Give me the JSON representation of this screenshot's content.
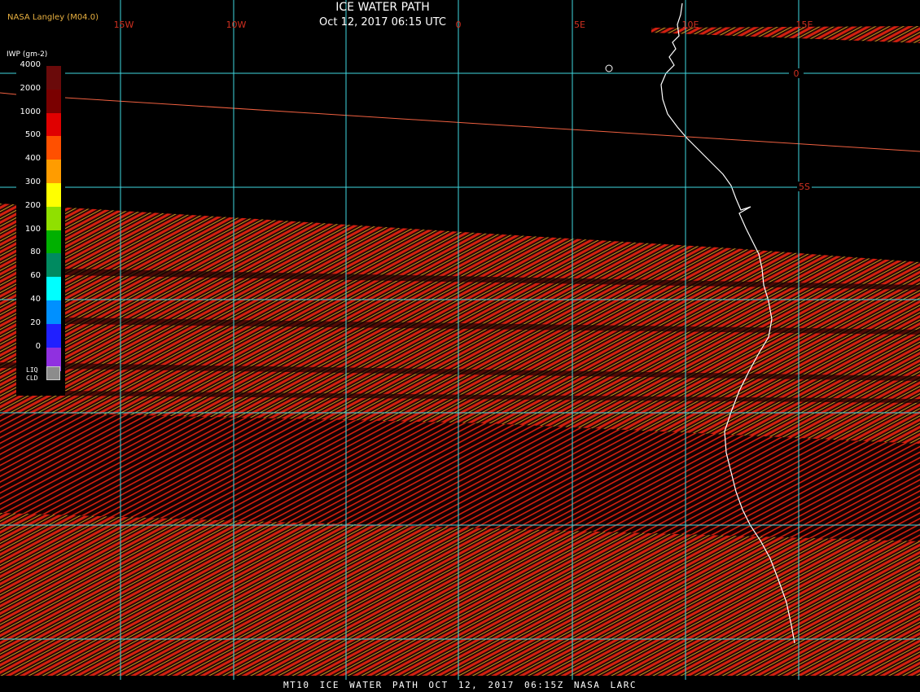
{
  "title": "ICE WATER PATH",
  "timestamp": "Oct 12, 2017 06:15 UTC",
  "source": "NASA Langley (M04.0)",
  "footer": "MT10  ICE WATER PATH  OCT 12, 2017 06:15Z  NASA LARC",
  "colors": {
    "grid": "#40d8e0",
    "tick_label": "#d03020",
    "coastline": "#ffffff",
    "swath_red": "#d42010",
    "swath_dark": "#2a0606",
    "swath_yellow": "#c0a020",
    "swath_violet": "#8040c0"
  },
  "grid": {
    "longitude_labels": [
      "15W",
      "10W",
      "0",
      "5E",
      "10E",
      "15E"
    ],
    "latitude_labels": [
      "0",
      "5S"
    ]
  },
  "legend": {
    "unit": "IWP (gm-2)",
    "levels": [
      {
        "label": "4000",
        "color": "#6a0a0a"
      },
      {
        "label": "2000",
        "color": "#7a0000"
      },
      {
        "label": "1000",
        "color": "#e00000"
      },
      {
        "label": "500",
        "color": "#ff5000"
      },
      {
        "label": "400",
        "color": "#ff9c00"
      },
      {
        "label": "300",
        "color": "#ffff00"
      },
      {
        "label": "200",
        "color": "#90e000"
      },
      {
        "label": "100",
        "color": "#00b000"
      },
      {
        "label": "80",
        "color": "#008a60"
      },
      {
        "label": "60",
        "color": "#00ffff"
      },
      {
        "label": "40",
        "color": "#0090ff"
      },
      {
        "label": "20",
        "color": "#2020ff"
      },
      {
        "label": "0",
        "color": "#9030e0"
      }
    ],
    "liquid_cloud_label": "LIQ CLD",
    "liquid_cloud_color": "#8c8c8c"
  }
}
